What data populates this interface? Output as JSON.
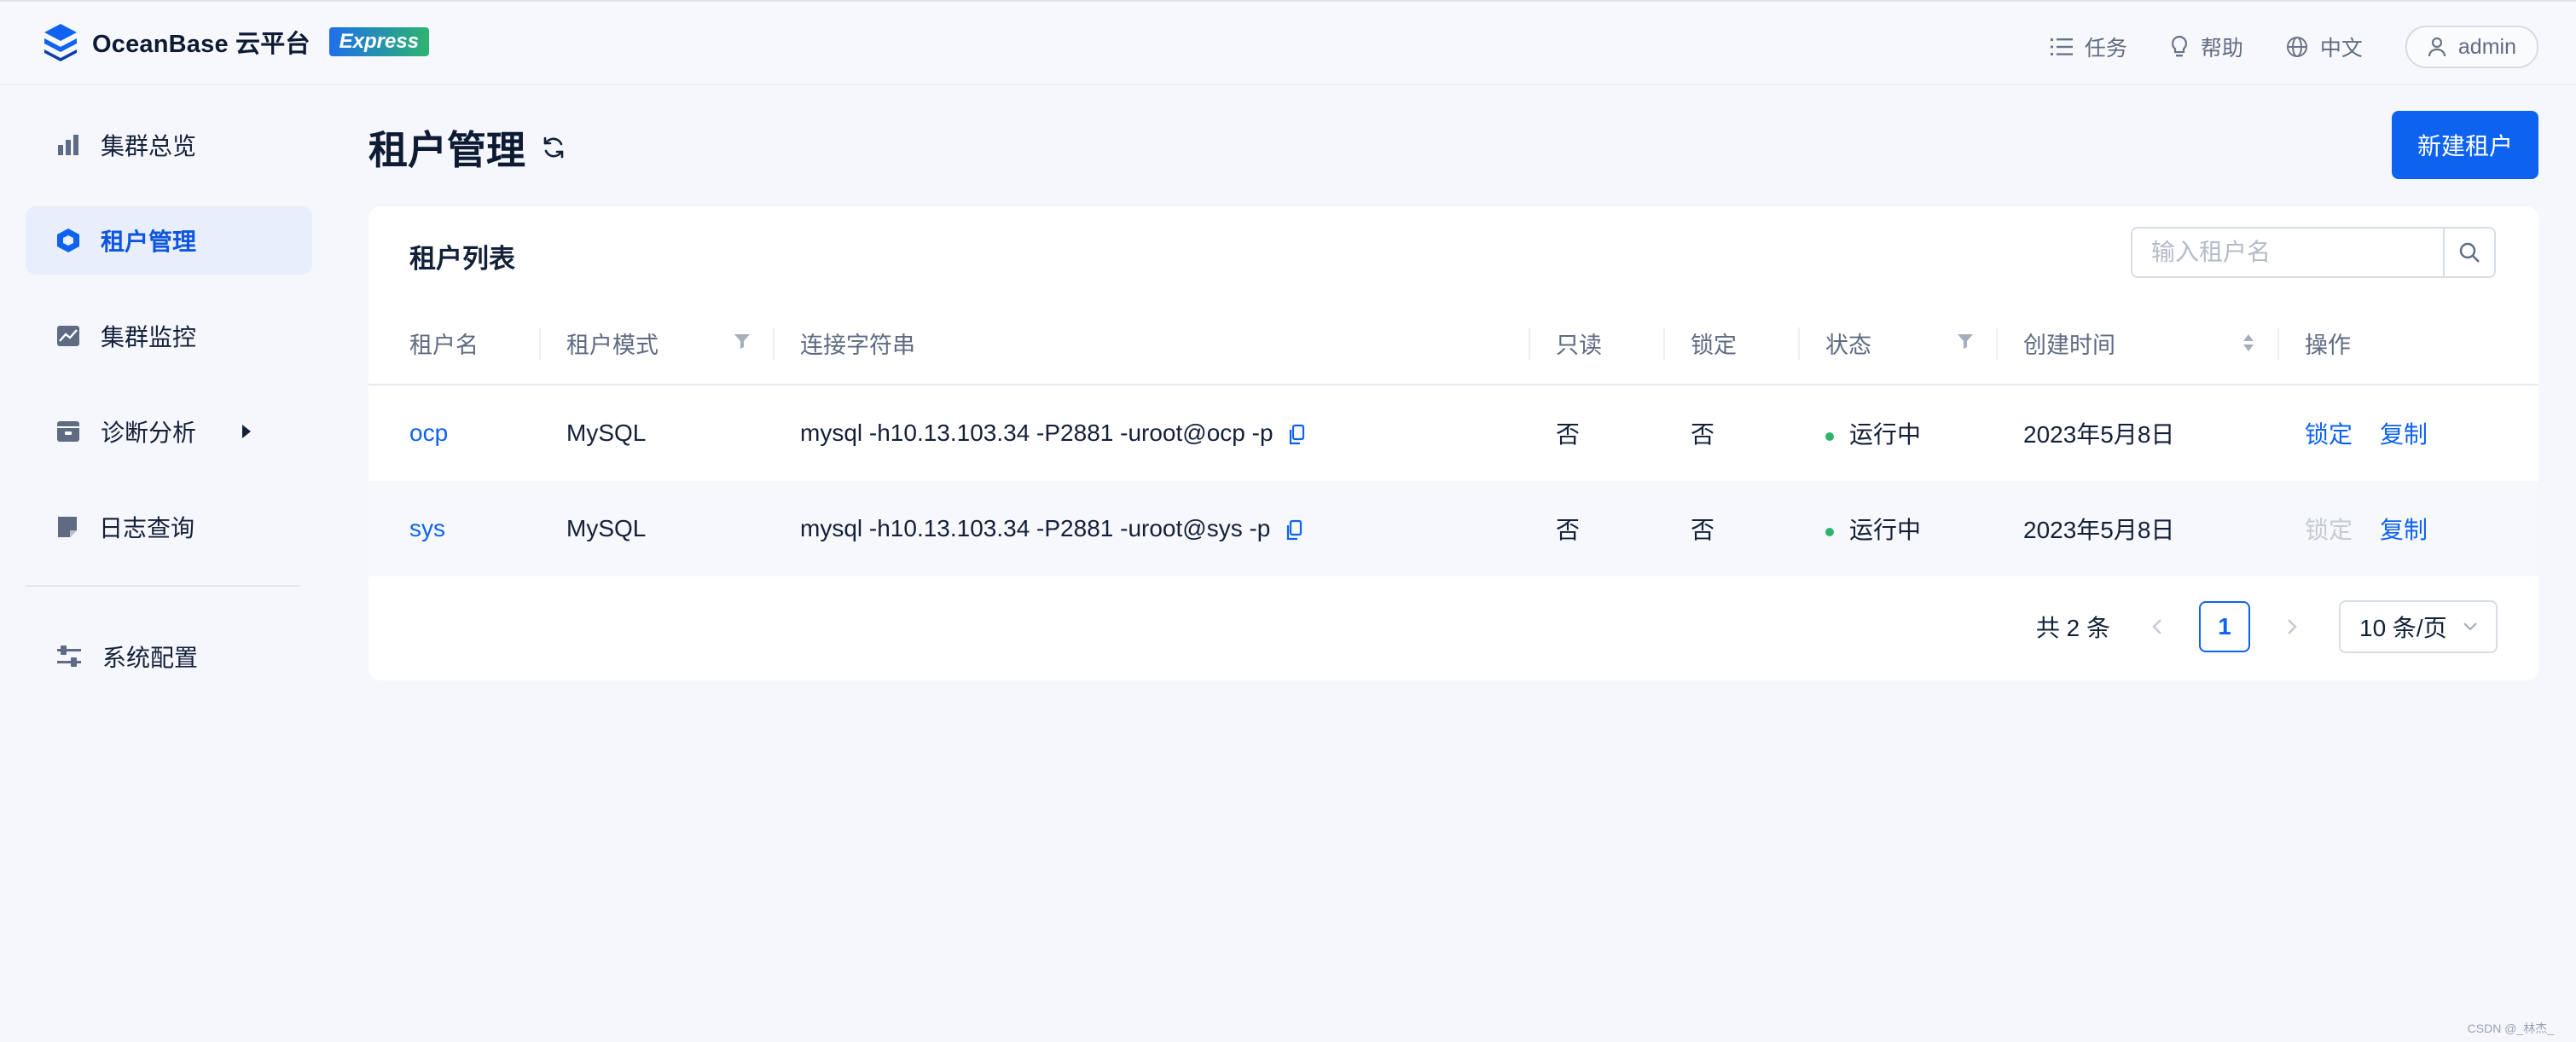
{
  "header": {
    "brand_name": "OceanBase 云平台",
    "brand_badge": "Express",
    "actions": [
      {
        "label": "任务",
        "icon": "list-icon"
      },
      {
        "label": "帮助",
        "icon": "lightbulb-icon"
      },
      {
        "label": "中文",
        "icon": "globe-icon"
      }
    ],
    "user": {
      "label": "admin",
      "icon": "user-icon"
    }
  },
  "sidebar": {
    "items": [
      {
        "label": "集群总览",
        "icon": "bar-chart-icon",
        "active": false
      },
      {
        "label": "租户管理",
        "icon": "hexagon-icon",
        "active": true
      },
      {
        "label": "集群监控",
        "icon": "area-chart-icon",
        "active": false
      },
      {
        "label": "诊断分析",
        "icon": "inbox-icon",
        "active": false,
        "expandable": true
      },
      {
        "label": "日志查询",
        "icon": "note-icon",
        "active": false
      },
      {
        "label": "系统配置",
        "icon": "sliders-icon",
        "active": false
      }
    ]
  },
  "page": {
    "title": "租户管理",
    "new_button": "新建租户"
  },
  "tenant_list": {
    "title": "租户列表",
    "search_placeholder": "输入租户名",
    "columns": [
      "租户名",
      "租户模式",
      "连接字符串",
      "只读",
      "锁定",
      "状态",
      "创建时间",
      "操作"
    ],
    "rows": [
      {
        "name": "ocp",
        "mode": "MySQL",
        "connection": "mysql -h10.13.103.34 -P2881 -uroot@ocp -p",
        "readonly": "否",
        "locked": "否",
        "status": "运行中",
        "created": "2023年5月8日",
        "actions": [
          "锁定",
          "复制"
        ],
        "lock_disabled": false
      },
      {
        "name": "sys",
        "mode": "MySQL",
        "connection": "mysql -h10.13.103.34 -P2881 -uroot@sys -p",
        "readonly": "否",
        "locked": "否",
        "status": "运行中",
        "created": "2023年5月8日",
        "actions": [
          "锁定",
          "复制"
        ],
        "lock_disabled": true
      }
    ],
    "pagination": {
      "total": "共 2 条",
      "current_page": "1",
      "page_size": "10 条/页"
    }
  },
  "watermark": "CSDN @_林杰_",
  "colors": {
    "primary": "#0e62f0",
    "status_running": "#2fb56b",
    "background": "#f5f7fc"
  }
}
